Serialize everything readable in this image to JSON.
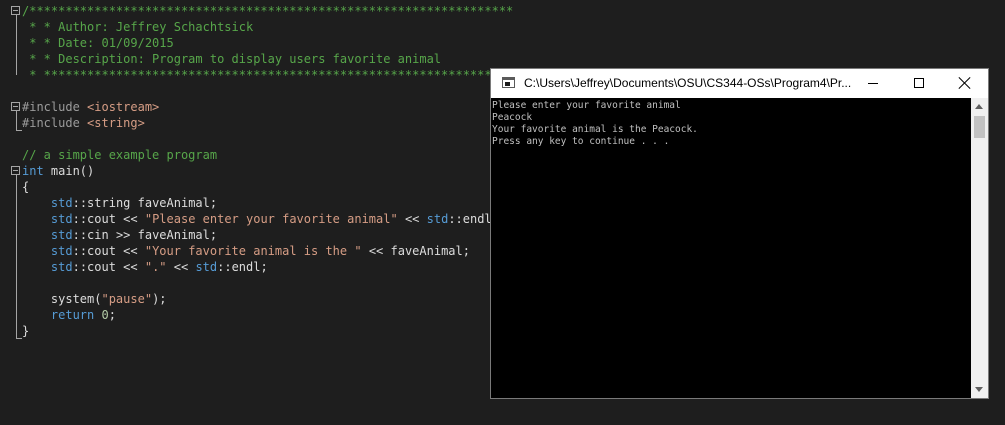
{
  "editor": {
    "lines": [
      {
        "id": "l1",
        "parts": [
          {
            "c": "cm",
            "t": "/*******************************************************************"
          }
        ]
      },
      {
        "id": "l2",
        "parts": [
          {
            "c": "cm",
            "t": " * * Author: Jeffrey Schachtsick"
          }
        ]
      },
      {
        "id": "l3",
        "parts": [
          {
            "c": "cm",
            "t": " * * Date: 01/09/2015"
          }
        ]
      },
      {
        "id": "l4",
        "parts": [
          {
            "c": "cm",
            "t": " * * Description: Program to display users favorite animal"
          }
        ]
      },
      {
        "id": "l5",
        "parts": [
          {
            "c": "cm",
            "t": " * ***************************************************************/"
          }
        ]
      },
      {
        "id": "l6",
        "parts": [
          {
            "c": "tx",
            "t": ""
          }
        ]
      },
      {
        "id": "l7",
        "parts": [
          {
            "c": "pp",
            "t": "#include "
          },
          {
            "c": "str",
            "t": "<iostream>"
          }
        ]
      },
      {
        "id": "l8",
        "parts": [
          {
            "c": "pp",
            "t": "#include "
          },
          {
            "c": "str",
            "t": "<string>"
          }
        ]
      },
      {
        "id": "l9",
        "parts": [
          {
            "c": "tx",
            "t": ""
          }
        ]
      },
      {
        "id": "l10",
        "parts": [
          {
            "c": "cm",
            "t": "// a simple example program"
          }
        ]
      },
      {
        "id": "l11",
        "parts": [
          {
            "c": "kw",
            "t": "int"
          },
          {
            "c": "tx",
            "t": " main()"
          }
        ]
      },
      {
        "id": "l12",
        "parts": [
          {
            "c": "tx",
            "t": "{"
          }
        ]
      },
      {
        "id": "l13",
        "parts": [
          {
            "c": "tx",
            "t": "    "
          },
          {
            "c": "kw",
            "t": "std"
          },
          {
            "c": "tx",
            "t": "::string faveAnimal;"
          }
        ]
      },
      {
        "id": "l14",
        "parts": [
          {
            "c": "tx",
            "t": "    "
          },
          {
            "c": "kw",
            "t": "std"
          },
          {
            "c": "tx",
            "t": "::cout << "
          },
          {
            "c": "str",
            "t": "\"Please enter your favorite animal\""
          },
          {
            "c": "tx",
            "t": " << "
          },
          {
            "c": "kw",
            "t": "std"
          },
          {
            "c": "tx",
            "t": "::endl;"
          }
        ]
      },
      {
        "id": "l15",
        "parts": [
          {
            "c": "tx",
            "t": "    "
          },
          {
            "c": "kw",
            "t": "std"
          },
          {
            "c": "tx",
            "t": "::cin >> faveAnimal;"
          }
        ]
      },
      {
        "id": "l16",
        "parts": [
          {
            "c": "tx",
            "t": "    "
          },
          {
            "c": "kw",
            "t": "std"
          },
          {
            "c": "tx",
            "t": "::cout << "
          },
          {
            "c": "str",
            "t": "\"Your favorite animal is the \""
          },
          {
            "c": "tx",
            "t": " << faveAnimal;"
          }
        ]
      },
      {
        "id": "l17",
        "parts": [
          {
            "c": "tx",
            "t": "    "
          },
          {
            "c": "kw",
            "t": "std"
          },
          {
            "c": "tx",
            "t": "::cout << "
          },
          {
            "c": "str",
            "t": "\".\""
          },
          {
            "c": "tx",
            "t": " << "
          },
          {
            "c": "kw",
            "t": "std"
          },
          {
            "c": "tx",
            "t": "::endl;"
          }
        ]
      },
      {
        "id": "l18",
        "parts": [
          {
            "c": "tx",
            "t": ""
          }
        ]
      },
      {
        "id": "l19",
        "parts": [
          {
            "c": "tx",
            "t": "    system("
          },
          {
            "c": "str",
            "t": "\"pause\""
          },
          {
            "c": "tx",
            "t": ");"
          }
        ]
      },
      {
        "id": "l20",
        "parts": [
          {
            "c": "tx",
            "t": "    "
          },
          {
            "c": "kw",
            "t": "return"
          },
          {
            "c": "tx",
            "t": " "
          },
          {
            "c": "num",
            "t": "0"
          },
          {
            "c": "tx",
            "t": ";"
          }
        ]
      },
      {
        "id": "l21",
        "parts": [
          {
            "c": "tx",
            "t": "}"
          }
        ]
      }
    ]
  },
  "console": {
    "title": "C:\\Users\\Jeffrey\\Documents\\OSU\\CS344-OSs\\Program4\\Pr...",
    "lines": [
      "Please enter your favorite animal",
      "Peacock",
      "Your favorite animal is the Peacock.",
      "Press any key to continue . . ."
    ]
  }
}
